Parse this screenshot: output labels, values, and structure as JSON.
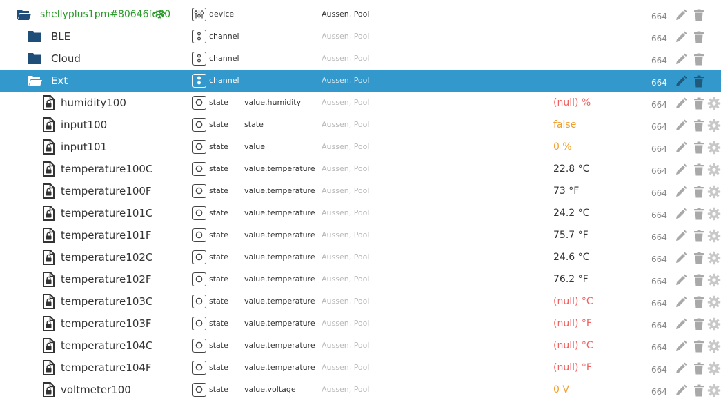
{
  "colors": {
    "device_name": "#2a9a2a",
    "selected_row": "#3399cc",
    "folder": "#1f4e79",
    "value_null": "#f06060",
    "value_warn": "#f0a030"
  },
  "rows": [
    {
      "kind": "device",
      "icon": "folder-open-icon",
      "name": "shellyplus1pm#80646fd80e00#",
      "type": "device",
      "role": "",
      "room": "Aussen, Pool",
      "value": "",
      "acl": "664"
    },
    {
      "kind": "channel",
      "icon": "folder-icon",
      "name": "BLE",
      "type": "channel",
      "role": "",
      "room": "Aussen, Pool",
      "value": "",
      "acl": "664"
    },
    {
      "kind": "channel",
      "icon": "folder-icon",
      "name": "Cloud",
      "type": "channel",
      "role": "",
      "room": "Aussen, Pool",
      "value": "",
      "acl": "664"
    },
    {
      "kind": "channel",
      "icon": "folder-open-icon",
      "name": "Ext",
      "type": "channel",
      "role": "",
      "room": "Aussen, Pool",
      "value": "",
      "acl": "664",
      "selected": true
    },
    {
      "kind": "state",
      "icon": "locked-file-icon",
      "name": "humidity100",
      "type": "state",
      "role": "value.humidity",
      "room": "Aussen, Pool",
      "value": "(null) %",
      "value_style": "null",
      "acl": "664"
    },
    {
      "kind": "state",
      "icon": "locked-file-icon",
      "name": "input100",
      "type": "state",
      "role": "state",
      "room": "Aussen, Pool",
      "value": "false",
      "value_style": "warn",
      "acl": "664"
    },
    {
      "kind": "state",
      "icon": "locked-file-icon",
      "name": "input101",
      "type": "state",
      "role": "value",
      "room": "Aussen, Pool",
      "value": "0 %",
      "value_style": "warn",
      "acl": "664"
    },
    {
      "kind": "state",
      "icon": "locked-file-icon",
      "name": "temperature100C",
      "type": "state",
      "role": "value.temperature",
      "room": "Aussen, Pool",
      "value": "22.8 °C",
      "value_style": "num",
      "acl": "664"
    },
    {
      "kind": "state",
      "icon": "locked-file-icon",
      "name": "temperature100F",
      "type": "state",
      "role": "value.temperature",
      "room": "Aussen, Pool",
      "value": "73 °F",
      "value_style": "num",
      "acl": "664"
    },
    {
      "kind": "state",
      "icon": "locked-file-icon",
      "name": "temperature101C",
      "type": "state",
      "role": "value.temperature",
      "room": "Aussen, Pool",
      "value": "24.2 °C",
      "value_style": "num",
      "acl": "664"
    },
    {
      "kind": "state",
      "icon": "locked-file-icon",
      "name": "temperature101F",
      "type": "state",
      "role": "value.temperature",
      "room": "Aussen, Pool",
      "value": "75.7 °F",
      "value_style": "num",
      "acl": "664"
    },
    {
      "kind": "state",
      "icon": "locked-file-icon",
      "name": "temperature102C",
      "type": "state",
      "role": "value.temperature",
      "room": "Aussen, Pool",
      "value": "24.6 °C",
      "value_style": "num",
      "acl": "664"
    },
    {
      "kind": "state",
      "icon": "locked-file-icon",
      "name": "temperature102F",
      "type": "state",
      "role": "value.temperature",
      "room": "Aussen, Pool",
      "value": "76.2 °F",
      "value_style": "num",
      "acl": "664"
    },
    {
      "kind": "state",
      "icon": "locked-file-icon",
      "name": "temperature103C",
      "type": "state",
      "role": "value.temperature",
      "room": "Aussen, Pool",
      "value": "(null) °C",
      "value_style": "null",
      "acl": "664"
    },
    {
      "kind": "state",
      "icon": "locked-file-icon",
      "name": "temperature103F",
      "type": "state",
      "role": "value.temperature",
      "room": "Aussen, Pool",
      "value": "(null) °F",
      "value_style": "null",
      "acl": "664"
    },
    {
      "kind": "state",
      "icon": "locked-file-icon",
      "name": "temperature104C",
      "type": "state",
      "role": "value.temperature",
      "room": "Aussen, Pool",
      "value": "(null) °C",
      "value_style": "null",
      "acl": "664"
    },
    {
      "kind": "state",
      "icon": "locked-file-icon",
      "name": "temperature104F",
      "type": "state",
      "role": "value.temperature",
      "room": "Aussen, Pool",
      "value": "(null) °F",
      "value_style": "null",
      "acl": "664"
    },
    {
      "kind": "state",
      "icon": "locked-file-icon",
      "name": "voltmeter100",
      "type": "state",
      "role": "value.voltage",
      "room": "Aussen, Pool",
      "value": "0 V",
      "value_style": "warn",
      "acl": "664"
    }
  ]
}
